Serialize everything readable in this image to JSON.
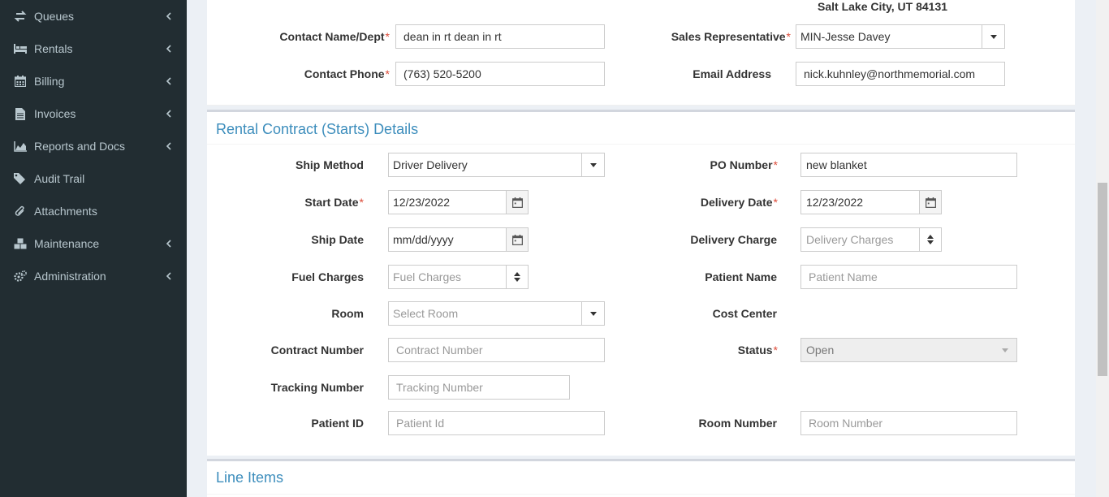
{
  "sidebar": {
    "items": [
      {
        "label": "Queues",
        "icon": "exchange-icon",
        "has_children": true
      },
      {
        "label": "Rentals",
        "icon": "bed-icon",
        "has_children": true
      },
      {
        "label": "Billing",
        "icon": "calendar-icon",
        "has_children": true
      },
      {
        "label": "Invoices",
        "icon": "file-icon",
        "has_children": true
      },
      {
        "label": "Reports and Docs",
        "icon": "area-chart-icon",
        "has_children": true
      },
      {
        "label": "Audit Trail",
        "icon": "tags-icon",
        "has_children": false
      },
      {
        "label": "Attachments",
        "icon": "paperclip-icon",
        "has_children": false
      },
      {
        "label": "Maintenance",
        "icon": "cubes-icon",
        "has_children": true
      },
      {
        "label": "Administration",
        "icon": "cogs-icon",
        "has_children": true
      }
    ]
  },
  "contact": {
    "city_line": "Salt Lake City, UT 84131",
    "contact_name_label": "Contact Name/Dept",
    "contact_name_value": "dean in rt dean in rt",
    "contact_phone_label": "Contact Phone",
    "contact_phone_value": "(763) 520-5200",
    "sales_rep_label": "Sales Representative",
    "sales_rep_value": "MIN-Jesse Davey",
    "email_label": "Email Address",
    "email_value": "nick.kuhnley@northmemorial.com",
    "required_mark": "*"
  },
  "rental": {
    "title": "Rental Contract (Starts) Details",
    "ship_method_label": "Ship Method",
    "ship_method_value": "Driver Delivery",
    "po_number_label": "PO Number",
    "po_number_value": "new blanket",
    "start_date_label": "Start Date",
    "start_date_value": "12/23/2022",
    "delivery_date_label": "Delivery Date",
    "delivery_date_value": "12/23/2022",
    "ship_date_label": "Ship Date",
    "ship_date_placeholder": "mm/dd/yyyy",
    "delivery_charge_label": "Delivery Charge",
    "delivery_charge_placeholder": "Delivery Charges",
    "fuel_charges_label": "Fuel Charges",
    "fuel_charges_placeholder": "Fuel Charges",
    "patient_name_label": "Patient Name",
    "patient_name_placeholder": "Patient Name",
    "room_label": "Room",
    "room_placeholder": "Select Room",
    "cost_center_label": "Cost Center",
    "contract_number_label": "Contract Number",
    "contract_number_placeholder": "Contract Number",
    "status_label": "Status",
    "status_value": "Open",
    "tracking_number_label": "Tracking Number",
    "tracking_number_placeholder": "Tracking Number",
    "patient_id_label": "Patient ID",
    "patient_id_placeholder": "Patient Id",
    "room_number_label": "Room Number",
    "room_number_placeholder": "Room Number"
  },
  "line_items": {
    "title": "Line Items"
  },
  "colors": {
    "sidebar_bg": "#222d32",
    "sidebar_text": "#b8c7ce",
    "accent": "#3c8dbc",
    "required": "#dd4b39"
  }
}
